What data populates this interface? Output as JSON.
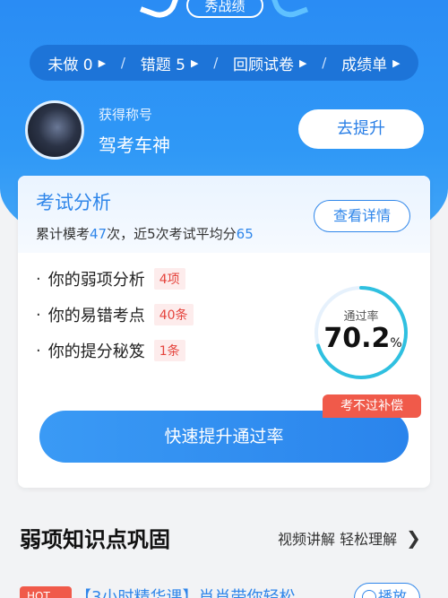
{
  "header": {
    "show_score_label": "秀战绩",
    "nav": [
      {
        "label": "未做 0"
      },
      {
        "label": "错题 5"
      },
      {
        "label": "回顾试卷"
      },
      {
        "label": "成绩单"
      }
    ]
  },
  "profile": {
    "title_label": "获得称号",
    "title_value": "驾考车神",
    "improve_button": "去提升"
  },
  "analysis": {
    "title": "考试分析",
    "summary_prefix": "累计模考",
    "mock_count": "47",
    "summary_mid": "次，近5次考试平均分",
    "avg_score": "65",
    "detail_button": "查看详情",
    "items": [
      {
        "label": "你的弱项分析",
        "tag": "4项"
      },
      {
        "label": "你的易错考点",
        "tag": "40条"
      },
      {
        "label": "你的提分秘笈",
        "tag": "1条"
      }
    ],
    "pass_rate_label": "通过率",
    "pass_rate_value": "70.2",
    "pass_rate_unit": "%",
    "pass_rate_fraction": 0.702,
    "compensate_badge": "考不过补偿",
    "fast_button": "快速提升通过率"
  },
  "weak_section": {
    "title": "弱项知识点巩固",
    "right_text": "视频讲解 轻松理解",
    "hot_badge": "HOT",
    "promo_text": "【3小时精华课】肖肖带你轻松",
    "play_button": "播放"
  },
  "colors": {
    "primary": "#2f86ea",
    "accent_red": "#f05a4a",
    "nav_bg": "#1d74d8"
  }
}
